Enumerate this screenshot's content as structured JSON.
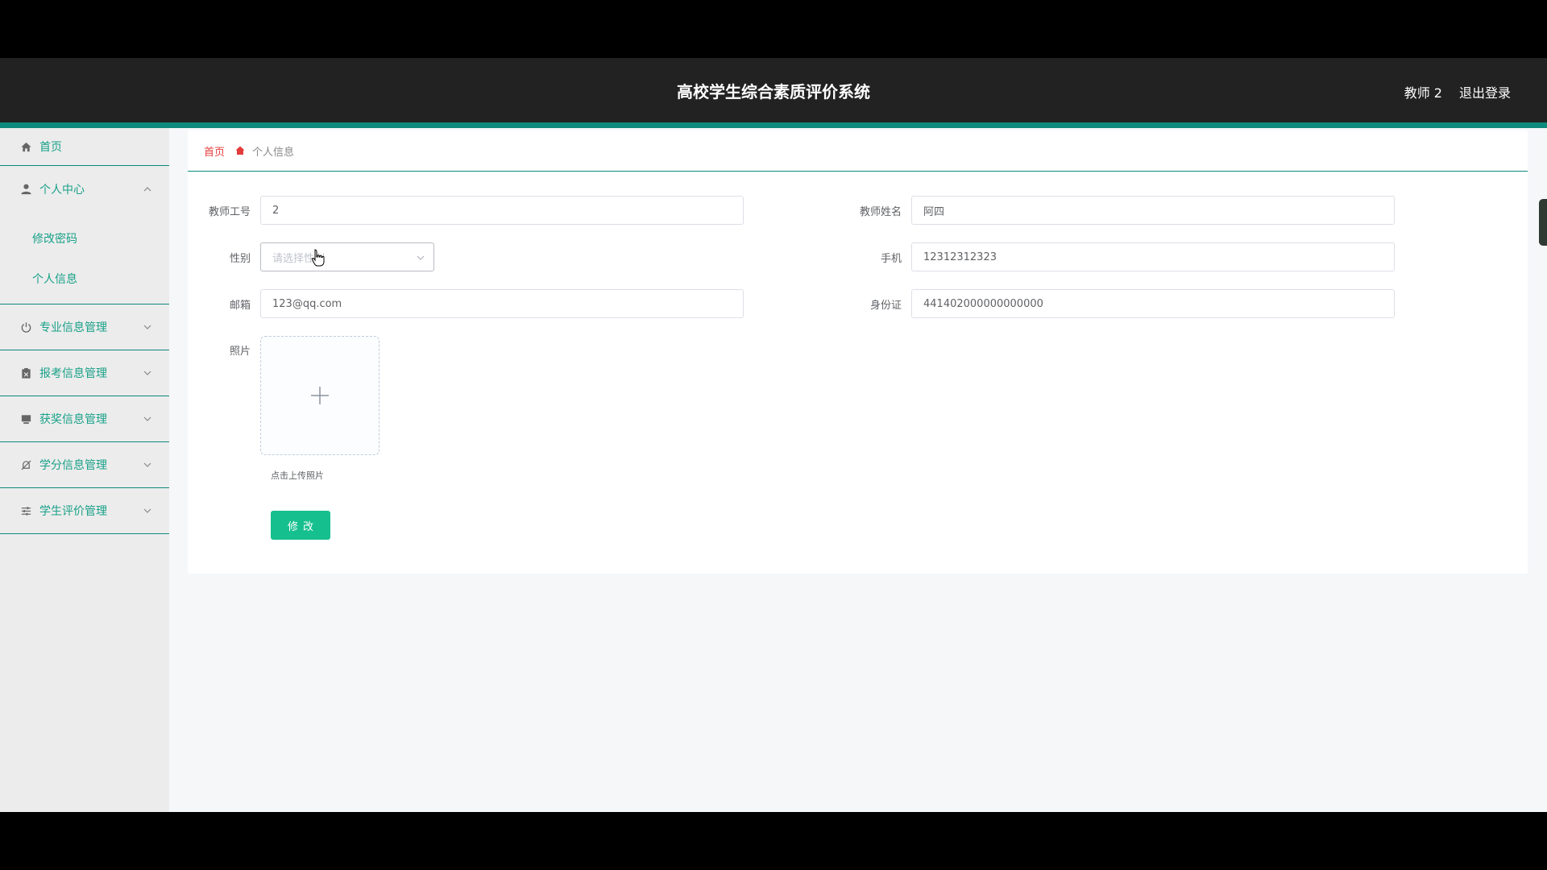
{
  "header": {
    "title": "高校学生综合素质评价系统",
    "user": "教师 2",
    "logout": "退出登录"
  },
  "sidebar": {
    "home": "首页",
    "personal_center": "个人中心",
    "personal_sub": [
      "修改密码",
      "个人信息"
    ],
    "groups": [
      "专业信息管理",
      "报考信息管理",
      "获奖信息管理",
      "学分信息管理",
      "学生评价管理"
    ]
  },
  "breadcrumb": {
    "home": "首页",
    "current": "个人信息"
  },
  "form": {
    "teacher_id_label": "教师工号",
    "teacher_id": "2",
    "teacher_name_label": "教师姓名",
    "teacher_name": "阿四",
    "gender_label": "性别",
    "gender_placeholder": "请选择性别",
    "phone_label": "手机",
    "phone": "12312312323",
    "email_label": "邮箱",
    "email": "123@qq.com",
    "idcard_label": "身份证",
    "idcard": "441402000000000000",
    "photo_label": "照片",
    "upload_tip": "点击上传照片",
    "submit": "修改"
  },
  "colors": {
    "accent": "#0d8a7c",
    "menu_text": "#19a188",
    "button": "#16bf8e",
    "header_bg": "#222222",
    "breadcrumb_home": "#e33b3b"
  }
}
